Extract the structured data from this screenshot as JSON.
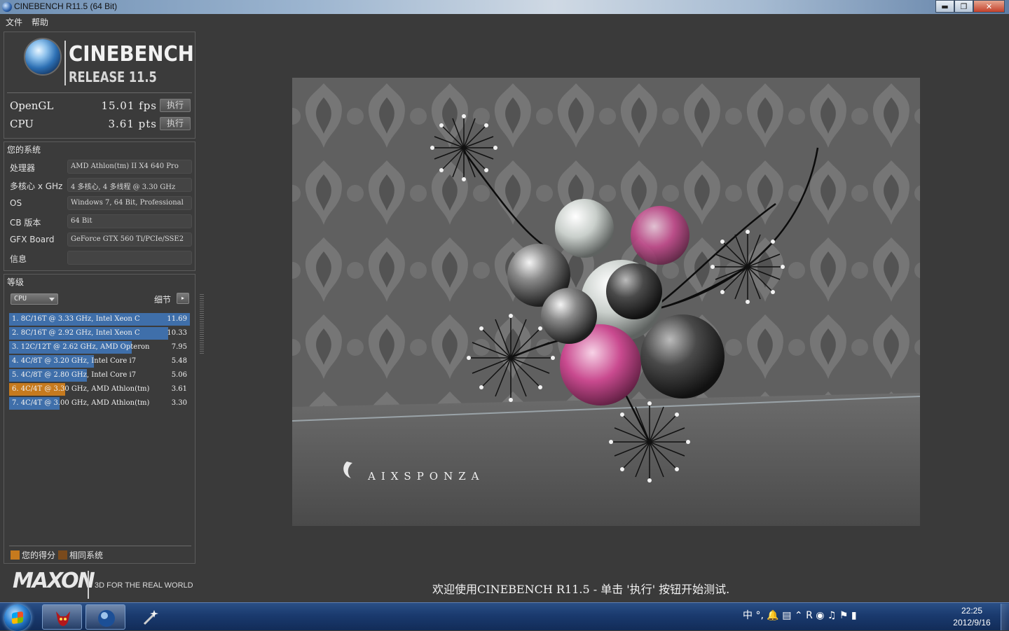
{
  "window": {
    "title": "CINEBENCH R11.5 (64 Bit)",
    "minimize": "▬",
    "restore": "❐",
    "close": "✕"
  },
  "menu": {
    "file": "文件",
    "help": "帮助"
  },
  "logo": {
    "title": "CINEBENCH",
    "release": "RELEASE 11.5"
  },
  "scores": {
    "opengl": {
      "label": "OpenGL",
      "value": "15.01 fps",
      "button": "执行"
    },
    "cpu": {
      "label": "CPU",
      "value": "3.61 pts",
      "button": "执行"
    }
  },
  "system": {
    "header": "您的系统",
    "rows": [
      {
        "key": "处理器",
        "value": "AMD Athlon(tm) II X4 640 Pro"
      },
      {
        "key": "多核心 x GHz",
        "value": "4 多核心, 4 多线程 @ 3.30 GHz"
      },
      {
        "key": "OS",
        "value": "Windows 7, 64 Bit, Professional"
      },
      {
        "key": "CB 版本",
        "value": "64 Bit"
      },
      {
        "key": "GFX Board",
        "value": "GeForce GTX 560 Ti/PCIe/SSE2"
      },
      {
        "key": "信息",
        "value": ""
      }
    ]
  },
  "ranking": {
    "header": "等级",
    "dropdown": "CPU",
    "detail_label": "细节",
    "detail_button": "▸",
    "items": [
      {
        "label": "1. 8C/16T @ 3.33 GHz, Intel Xeon C",
        "score": "11.69",
        "fraction": 1.0,
        "mine": false
      },
      {
        "label": "2. 8C/16T @ 2.92 GHz, Intel Xeon C",
        "score": "10.33",
        "fraction": 0.88,
        "mine": false
      },
      {
        "label": "3. 12C/12T @ 2.62 GHz, AMD Opteron",
        "score": "7.95",
        "fraction": 0.68,
        "mine": false
      },
      {
        "label": "4. 4C/8T @ 3.20 GHz, Intel Core i7",
        "score": "5.48",
        "fraction": 0.47,
        "mine": false
      },
      {
        "label": "5. 4C/8T @ 2.80 GHz, Intel Core i7",
        "score": "5.06",
        "fraction": 0.43,
        "mine": false
      },
      {
        "label": "6. 4C/4T @ 3.30 GHz, AMD Athlon(tm)",
        "score": "3.61",
        "fraction": 0.31,
        "mine": true
      },
      {
        "label": "7. 4C/4T @ 3.00 GHz, AMD Athlon(tm)",
        "score": "3.30",
        "fraction": 0.28,
        "mine": false
      }
    ],
    "legend_mine": "您的得分",
    "legend_similar": "相同系统"
  },
  "footer": {
    "brand": "MAXON",
    "tagline": "3D FOR THE REAL WORLD"
  },
  "render": {
    "watermark": "AIXSPONZA"
  },
  "status": "欢迎使用CINEBENCH R11.5 - 单击 '执行' 按钮开始测试.",
  "taskbar": {
    "tray": "中 °, 🔔 ▤ ⌃ R ◉ ♫ ⚑ ▮",
    "time": "22:25",
    "date": "2012/9/16"
  },
  "colors": {
    "bar_blue": "#3f6faa",
    "bar_mine": "#c67a1e",
    "similar": "#7a4a1c"
  }
}
